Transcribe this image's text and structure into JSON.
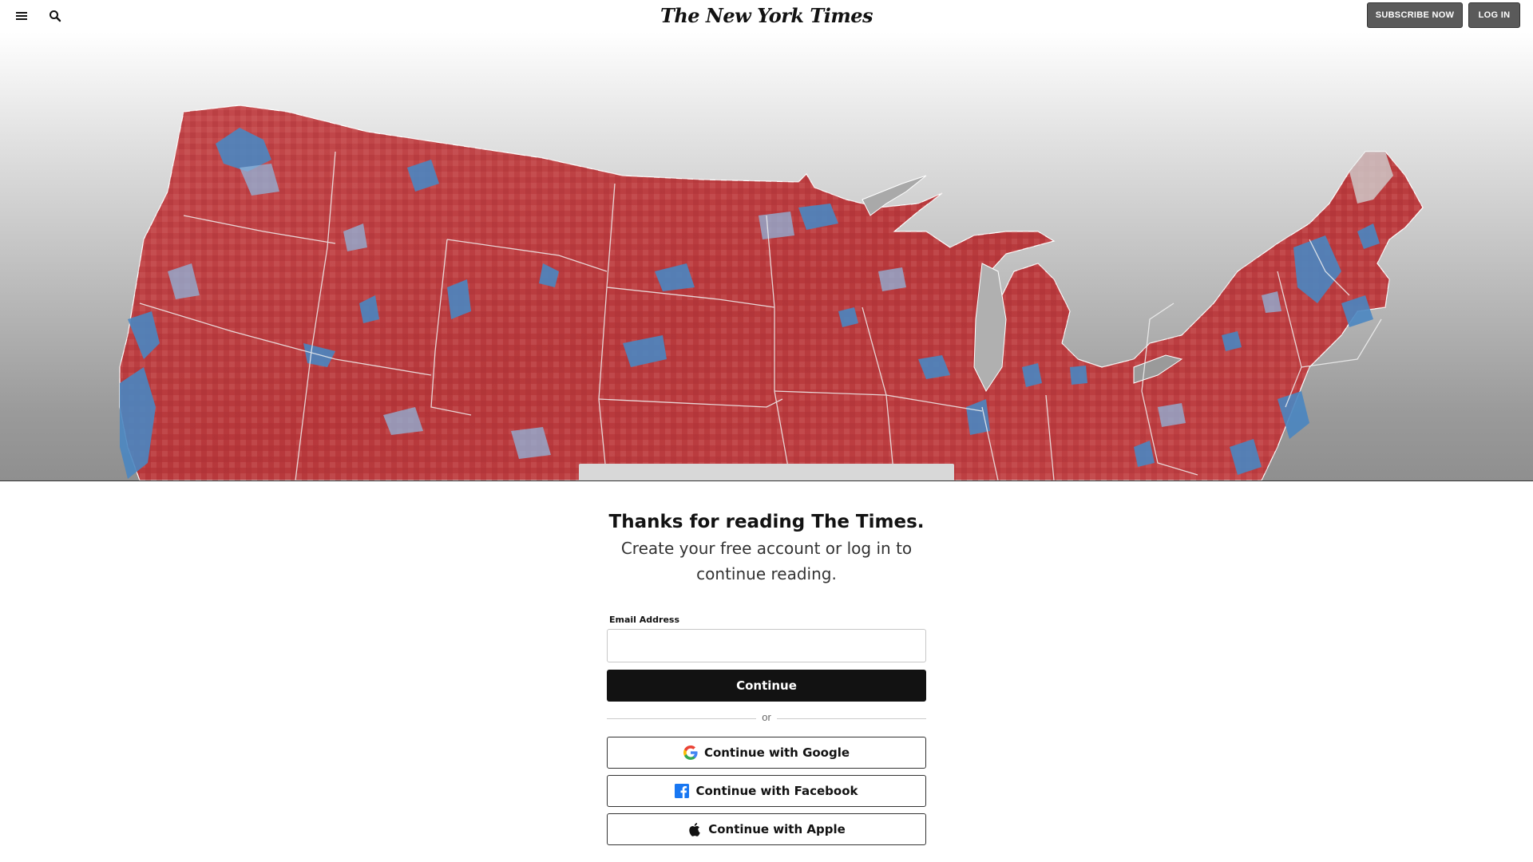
{
  "header": {
    "menu_icon": "hamburger-menu-icon",
    "search_icon": "search-icon",
    "logo_text": "The New York Times",
    "subscribe_label": "SUBSCRIBE NOW",
    "login_label": "LOG IN"
  },
  "hero": {
    "image": "us-county-election-results-map",
    "colors": {
      "republican": "#c0393b",
      "democrat": "#4a86c1",
      "border": "#ffffff"
    }
  },
  "regiwall": {
    "headline": "Thanks for reading The Times.",
    "subline": "Create your free account or log in to continue reading.",
    "email_label": "Email Address",
    "email_value": "",
    "continue_label": "Continue",
    "or_label": "or",
    "google_label": "Continue with Google",
    "facebook_label": "Continue with Facebook",
    "apple_label": "Continue with Apple",
    "icons": [
      "google-icon",
      "facebook-icon",
      "apple-icon"
    ]
  }
}
